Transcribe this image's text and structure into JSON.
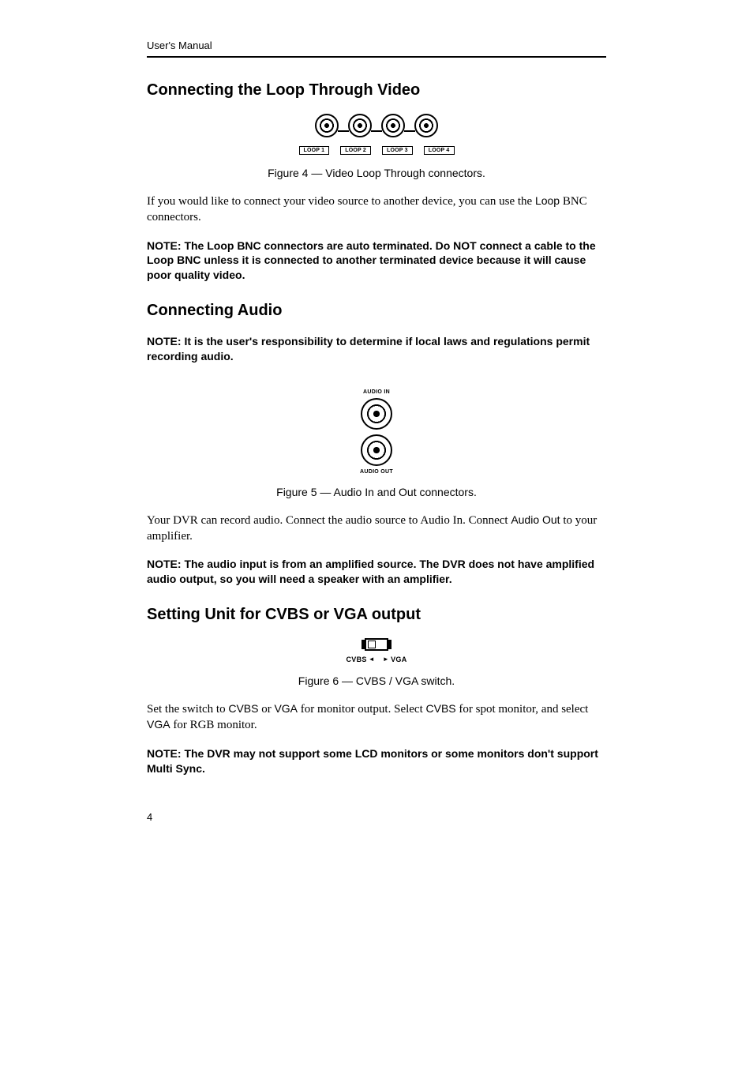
{
  "header": {
    "title": "User's Manual"
  },
  "section1": {
    "heading": "Connecting the Loop Through Video",
    "fig": {
      "labels": [
        "LOOP 1",
        "LOOP 2",
        "LOOP 3",
        "LOOP 4"
      ],
      "caption": "Figure 4 — Video Loop Through connectors."
    },
    "para1_a": "If you would like to connect your video source to another device, you can use the ",
    "para1_loop": "Loop",
    "para1_b": " BNC connectors.",
    "note": "NOTE:  The Loop BNC connectors are auto terminated.  Do NOT connect a cable to the Loop BNC unless it is connected to another terminated device because it will cause poor quality video."
  },
  "section2": {
    "heading": "Connecting Audio",
    "note_top": "NOTE:  It is the user's responsibility to determine if local laws and regulations permit recording audio.",
    "fig": {
      "label_in": "AUDIO IN",
      "label_out": "AUDIO OUT",
      "caption": "Figure 5 — Audio In and Out connectors."
    },
    "para_a": "Your DVR can record audio.  Connect the audio source to Audio In.  Connect ",
    "para_audio_out": "Audio Out",
    "para_b": " to your amplifier.",
    "note_bottom": "NOTE:  The audio input is from an amplified source.  The DVR does not have amplified audio output, so you will need a speaker with an amplifier."
  },
  "section3": {
    "heading": "Setting Unit for CVBS or VGA output",
    "fig": {
      "label_left": "CVBS",
      "label_right": "VGA",
      "caption": "Figure 6 — CVBS / VGA switch."
    },
    "para_a": "Set the switch to ",
    "para_cvbs": "CVBS",
    "para_b": " or ",
    "para_vga": "VGA",
    "para_c": " for monitor output.  Select ",
    "para_cvbs2": "CVBS",
    "para_d": " for spot monitor, and select ",
    "para_vga2": "VGA",
    "para_e": " for RGB monitor.",
    "note": "NOTE:  The DVR may not support some LCD monitors or some monitors don't support Multi Sync."
  },
  "footer": {
    "page_number": "4"
  }
}
